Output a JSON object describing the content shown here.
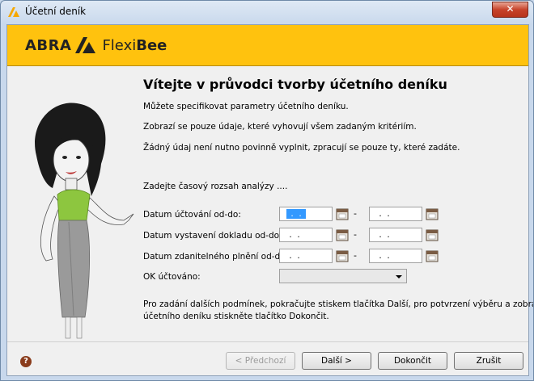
{
  "window": {
    "title": "Účetní deník",
    "close_label": "✕"
  },
  "brand": {
    "abra": "ABRA",
    "flexi": "Flexi",
    "bee": "Bee"
  },
  "wizard": {
    "heading": "Vítejte v průvodci tvorby účetního deníku",
    "intro1": "Můžete specifikovat parametry účetního deníku.",
    "intro2": "Zobrazí se pouze údaje, které vyhovují všem zadaným kritériím.",
    "intro3": "Žádný údaj není nutno povinně vyplnit, zpracují se pouze ty, které zadáte.",
    "range_prompt": "Zadejte časový rozsah analýzy ....",
    "fields": [
      {
        "label": "Datum účtování od-do:",
        "from": " .  . ",
        "to": " .  . ",
        "separator": "-"
      },
      {
        "label": "Datum vystavení dokladu od-do:",
        "from": " .  . ",
        "to": " .  . ",
        "separator": "-"
      },
      {
        "label": "Datum zdanitelného plnění od-do:",
        "from": " .  . ",
        "to": " .  . ",
        "separator": "-"
      }
    ],
    "ok_label": "OK účtováno:",
    "ok_value": "",
    "footer_text1": "Pro zadání dalších podmínek, pokračujte stiskem tlačítka Další, pro potvrzení výběru a zobrazení",
    "footer_text2": "účetního deníku stiskněte tlačítko Dokončit."
  },
  "buttons": {
    "prev": "< Předchozí",
    "next": "Další >",
    "finish": "Dokončit",
    "cancel": "Zrušit",
    "help": "?"
  },
  "colors": {
    "banner": "#ffc20e",
    "selection": "#3399ff",
    "dress": "#8dc63f"
  },
  "icons": {
    "title": "abra-logo-icon",
    "calendar": "calendar-icon",
    "help": "help-icon",
    "dropdown": "chevron-down-icon"
  }
}
